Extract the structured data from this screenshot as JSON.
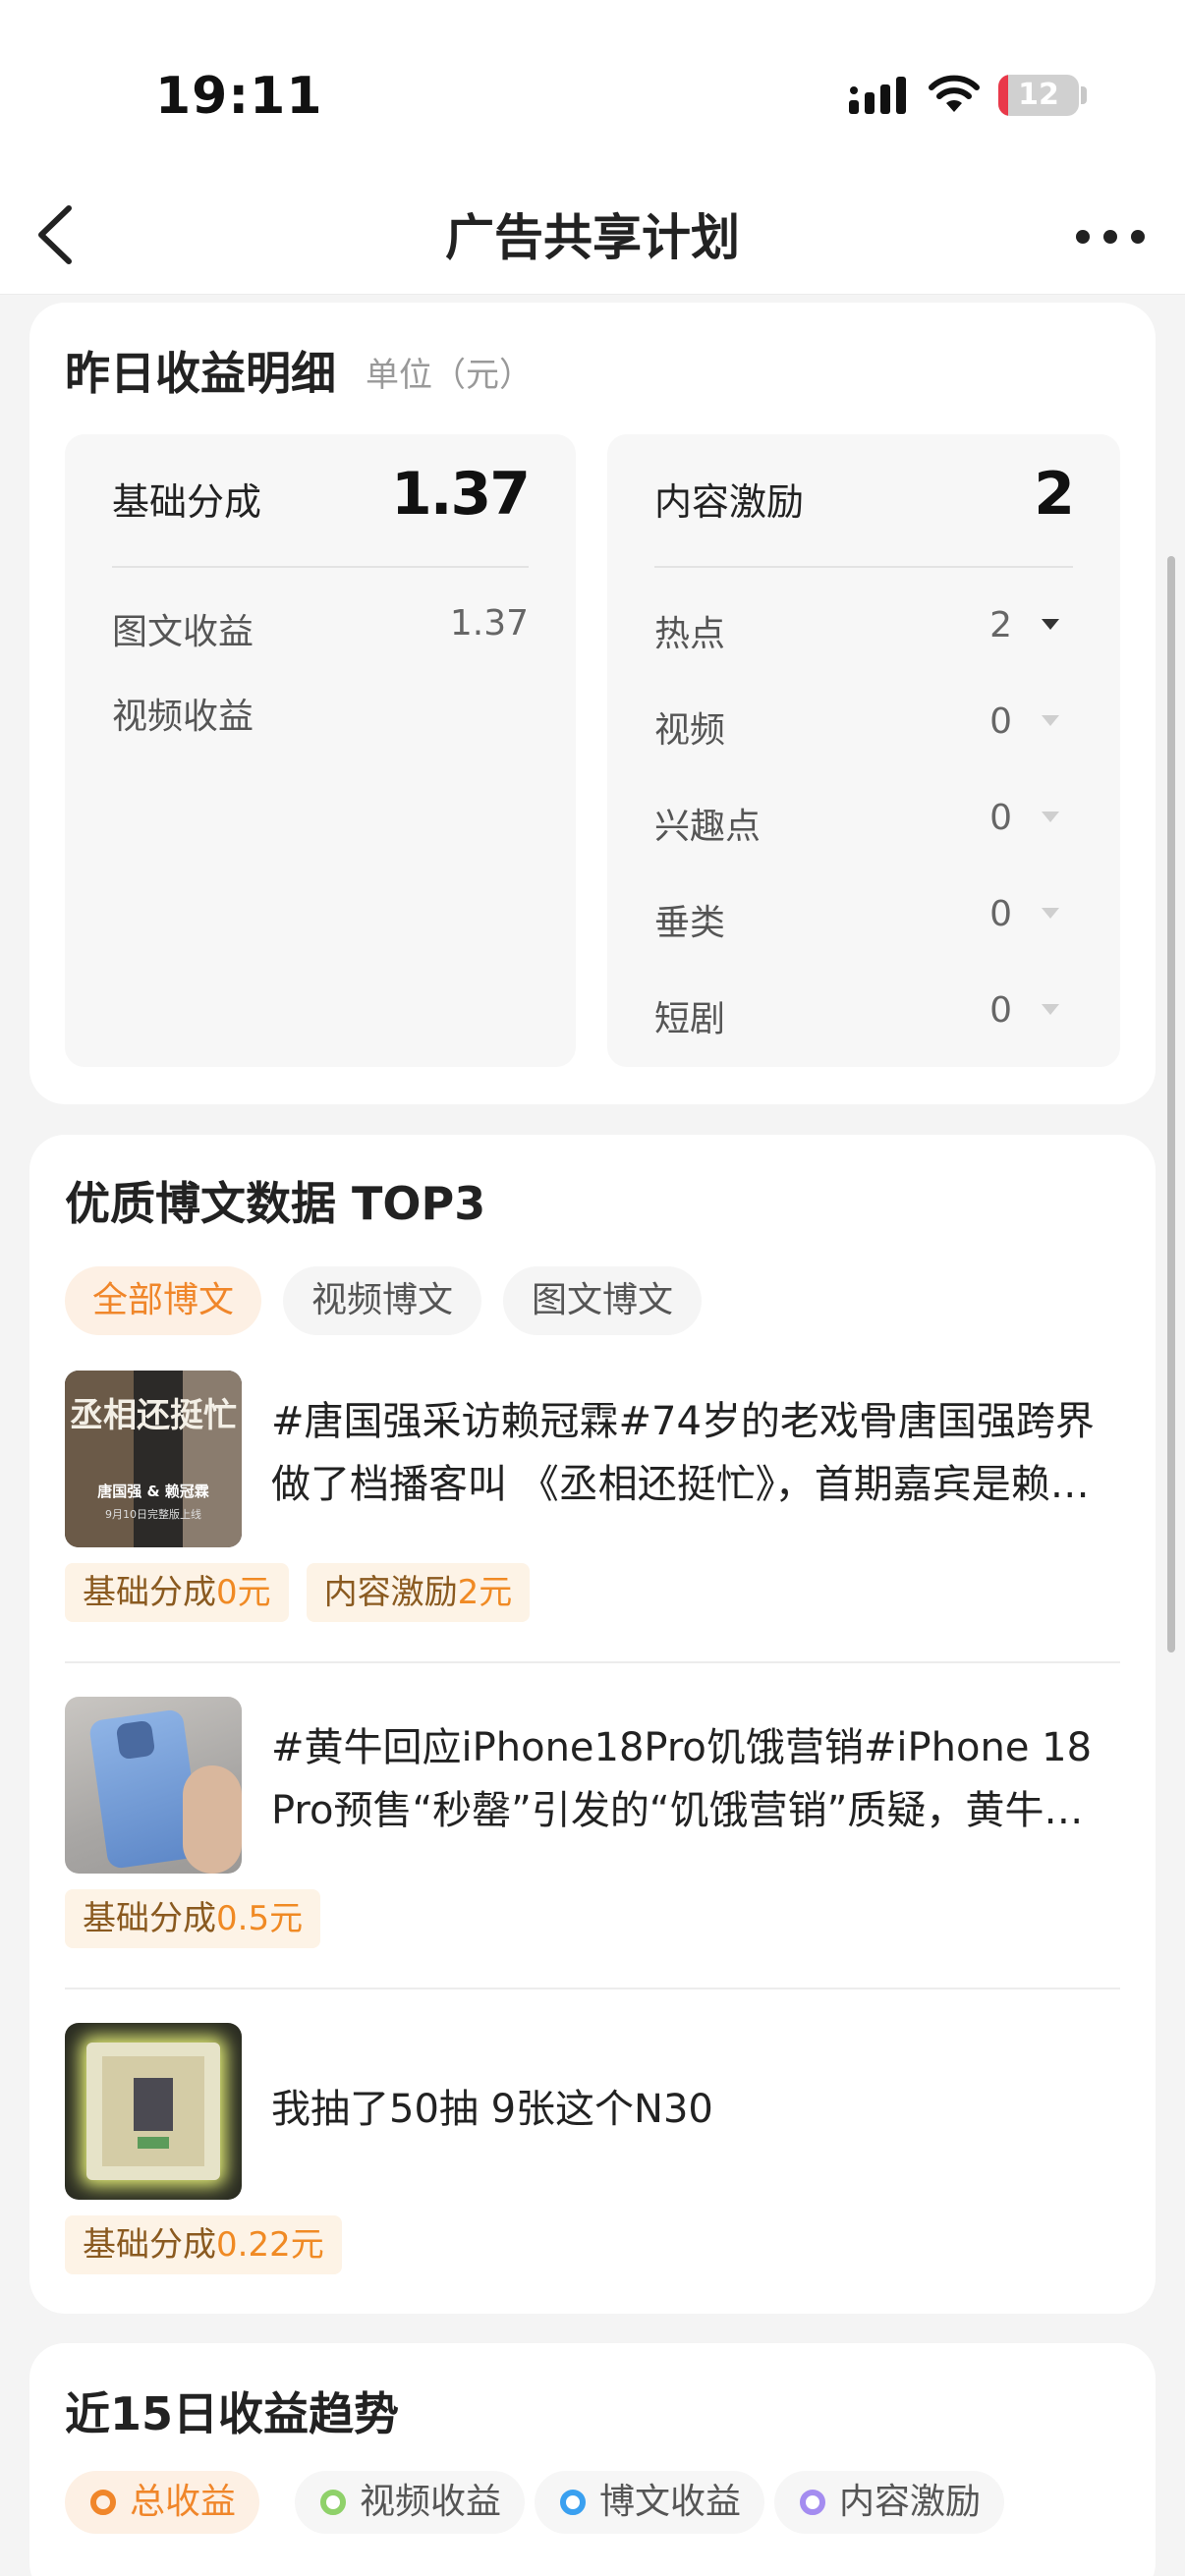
{
  "status_bar": {
    "time": "19:11",
    "battery": "12",
    "battery_fraction": 0.12,
    "battery_color": "#e9394a"
  },
  "nav": {
    "title": "广告共享计划",
    "back_icon": "chevron-left-icon",
    "more_icon": "more-horizontal-icon"
  },
  "yesterday": {
    "title": "昨日收益明细",
    "unit": "单位（元）",
    "base": {
      "label": "基础分成",
      "value": "1.37",
      "rows": [
        {
          "label": "图文收益",
          "value": "1.37"
        },
        {
          "label": "视频收益",
          "value": ""
        }
      ]
    },
    "incentive": {
      "label": "内容激励",
      "value": "2",
      "rows": [
        {
          "label": "热点",
          "value": "2",
          "expanded_icon": "caret-down-icon-dark"
        },
        {
          "label": "视频",
          "value": "0",
          "expanded_icon": "caret-down-icon-light"
        },
        {
          "label": "兴趣点",
          "value": "0",
          "expanded_icon": "caret-down-icon-light"
        },
        {
          "label": "垂类",
          "value": "0",
          "expanded_icon": "caret-down-icon-light"
        },
        {
          "label": "短剧",
          "value": "0",
          "expanded_icon": "caret-down-icon-light"
        }
      ]
    }
  },
  "top3": {
    "title": "优质博文数据 TOP3",
    "tabs": [
      {
        "label": "全部博文",
        "active": true
      },
      {
        "label": "视频博文",
        "active": false
      },
      {
        "label": "图文博文",
        "active": false
      }
    ],
    "posts": [
      {
        "text": "#唐国强采访赖冠霖#74岁的老戏骨唐国强跨界做了档播客叫 《丞相还挺忙》，首期嘉宾是赖冠霖",
        "thumb_title": "丞相还挺忙",
        "thumb_names": "唐国强 & 赖冠霖",
        "thumb_date": "9月10日完整版上线",
        "tags": [
          {
            "prefix": "基础分成",
            "amount": "0元"
          },
          {
            "prefix": "内容激励",
            "amount": "2元"
          }
        ]
      },
      {
        "text": "#黄牛回应iPhone18Pro饥饿营销#iPhone 18 Pro预售“秒罄”引发的“饥饿营销”质疑，黄牛回应",
        "tags": [
          {
            "prefix": "基础分成",
            "amount": "0.5元"
          }
        ]
      },
      {
        "text": "我抽了50抽 9张这个N30",
        "tags": [
          {
            "prefix": "基础分成",
            "amount": "0.22元"
          }
        ]
      }
    ]
  },
  "trend": {
    "title": "近15日收益趋势",
    "legend": [
      {
        "label": "总收益",
        "color": "#f0862a",
        "active": true
      },
      {
        "label": "视频收益",
        "color": "#8fd16a",
        "active": false
      },
      {
        "label": "博文收益",
        "color": "#3aa0f0",
        "active": false
      },
      {
        "label": "内容激励",
        "color": "#a48cf0",
        "active": false
      }
    ]
  }
}
